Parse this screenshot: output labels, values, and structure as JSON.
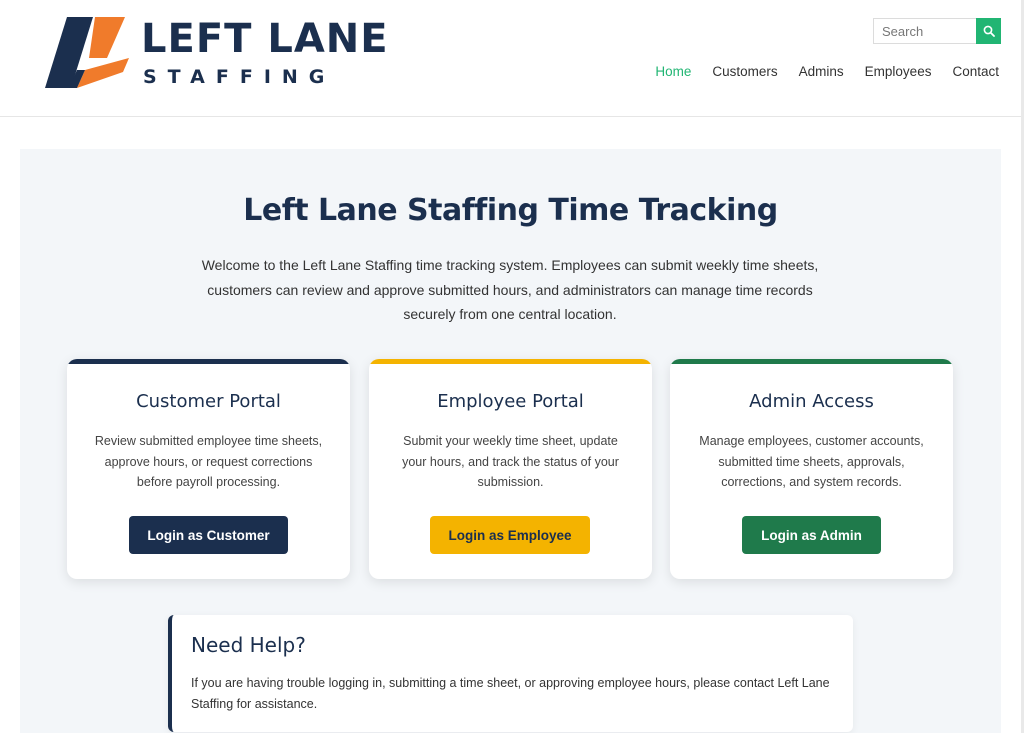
{
  "header": {
    "logo": {
      "word": "LEFT LANE",
      "sub": "STAFFING",
      "colors": {
        "navy": "#1b2f4e",
        "orange": "#f07b2b"
      }
    },
    "search": {
      "placeholder": "Search",
      "button_icon": "search-icon"
    },
    "nav": [
      {
        "label": "Home",
        "active": true
      },
      {
        "label": "Customers",
        "active": false
      },
      {
        "label": "Admins",
        "active": false
      },
      {
        "label": "Employees",
        "active": false
      },
      {
        "label": "Contact",
        "active": false
      }
    ]
  },
  "main": {
    "title": "Left Lane Staffing Time Tracking",
    "intro": "Welcome to the Left Lane Staffing time tracking system. Employees can submit weekly time sheets, customers can review and approve submitted hours, and administrators can manage time records securely from one central location.",
    "cards": [
      {
        "title": "Customer Portal",
        "text": "Review submitted employee time sheets, approve hours, or request corrections before payroll processing.",
        "button": "Login as Customer",
        "accent": "#1b2f4e"
      },
      {
        "title": "Employee Portal",
        "text": "Submit your weekly time sheet, update your hours, and track the status of your submission.",
        "button": "Login as Employee",
        "accent": "#f4b300"
      },
      {
        "title": "Admin Access",
        "text": "Manage employees, customer accounts, submitted time sheets, approvals, corrections, and system records.",
        "button": "Login as Admin",
        "accent": "#1f7a4b"
      }
    ],
    "help": {
      "title": "Need Help?",
      "text": "If you are having trouble logging in, submitting a time sheet, or approving employee hours, please contact Left Lane Staffing for assistance."
    }
  },
  "colors": {
    "accent_green": "#21b573",
    "panel_bg": "#f3f6f9"
  }
}
